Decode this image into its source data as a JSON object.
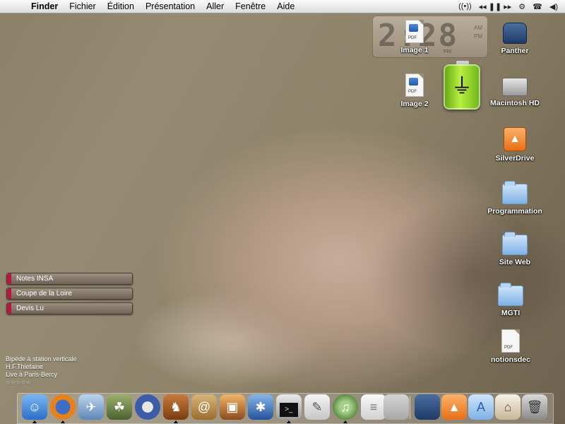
{
  "menubar": {
    "items": [
      "Finder",
      "Fichier",
      "Édition",
      "Présentation",
      "Aller",
      "Fenêtre",
      "Aide"
    ],
    "extras": [
      "airport-icon",
      "media-controls-icon",
      "gear-icon",
      "phone-icon",
      "volume-icon"
    ]
  },
  "clock": {
    "digits": "2:28",
    "am": "AM",
    "pm": "PM",
    "day": "FRI"
  },
  "desktop_icons": [
    "Image 1",
    "Panther",
    "Image 2",
    "Macintosh HD",
    "SilverDrive",
    "Programmation",
    "Site Web",
    "MGTI",
    "notionsdec"
  ],
  "pdf_tag": "PDF",
  "notes": [
    "Notes INSA",
    "Coupe de la Loire",
    "Devis Lu"
  ],
  "now_playing": {
    "track": "Bipède à station verticale",
    "artist": "H.F.Thiefaine",
    "album": "Live à Paris-Bercy",
    "rating": "☆☆☆☆☆"
  },
  "dock": {
    "apps": [
      "finder-icon",
      "firefox-icon",
      "mail-icon",
      "yoda-icon",
      "system-preferences-icon",
      "adium-icon",
      "address-book-icon",
      "iphoto-icon",
      "imovie-icon",
      "terminal-icon",
      "textedit-icon",
      "itunes-icon",
      "textedit-doc-icon",
      "apple-dock-icon"
    ],
    "docs": [
      "panther-dock-icon",
      "silverdrive-dock-icon",
      "applications-folder-icon",
      "home-folder-icon",
      "trash-icon"
    ]
  },
  "colors": {
    "accent": "#3a6fd0",
    "note_pin": "#b8183a",
    "battery": "#8ccf2a"
  }
}
